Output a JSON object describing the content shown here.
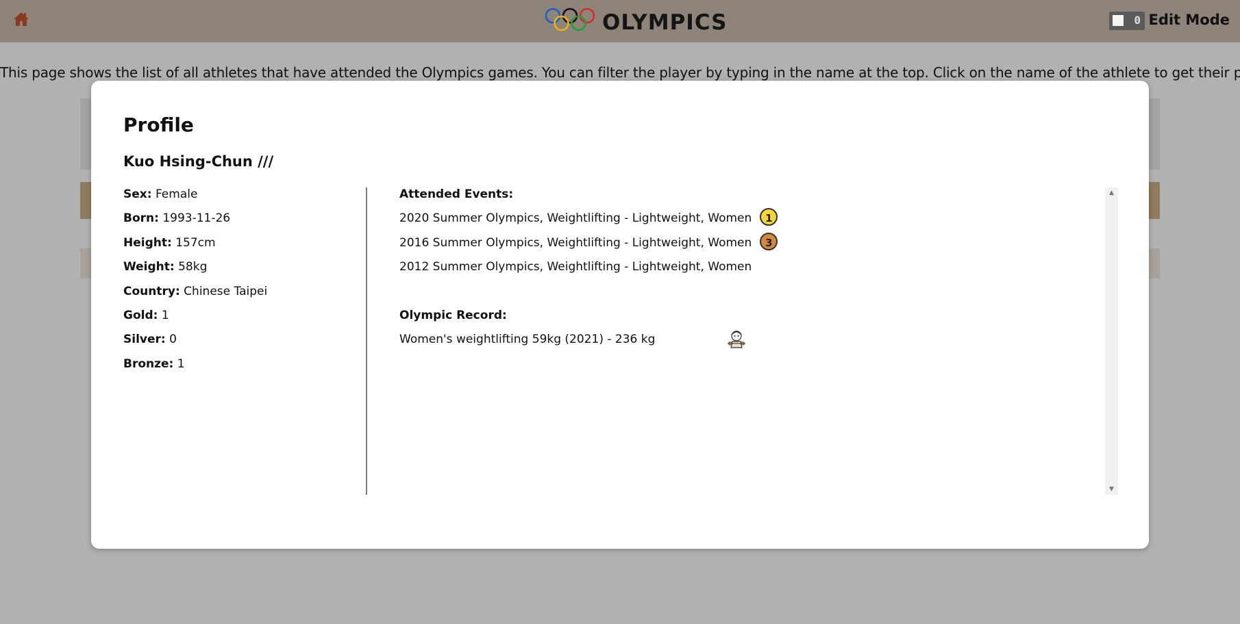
{
  "header": {
    "brand": "OLYMPICS",
    "toggle_value": "0",
    "edit_mode_label": "Edit Mode"
  },
  "intro_text": "This page shows the list of all athletes that have attended the Olympics games. You can filter the player by typing in the name at the top. Click on the name of the athlete to get their profile.",
  "modal": {
    "title": "Profile",
    "athlete_name": "Kuo Hsing-Chun ///",
    "stats": [
      {
        "label": "Sex:",
        "value": "Female"
      },
      {
        "label": "Born:",
        "value": "1993-11-26"
      },
      {
        "label": "Height:",
        "value": "157cm"
      },
      {
        "label": "Weight:",
        "value": "58kg"
      },
      {
        "label": "Country:",
        "value": "Chinese Taipei"
      },
      {
        "label": "Gold:",
        "value": "1"
      },
      {
        "label": "Silver:",
        "value": "0"
      },
      {
        "label": "Bronze:",
        "value": "1"
      }
    ],
    "events_title": "Attended Events:",
    "events": [
      {
        "text": "2020 Summer Olympics, Weightlifting - Lightweight, Women",
        "medal": "1",
        "medal_type": "gold"
      },
      {
        "text": "2016 Summer Olympics, Weightlifting - Lightweight, Women",
        "medal": "3",
        "medal_type": "bronze"
      },
      {
        "text": "2012 Summer Olympics, Weightlifting - Lightweight, Women",
        "medal": "",
        "medal_type": ""
      }
    ],
    "record_title": "Olympic Record:",
    "record_text": "Women's weightlifting 59kg (2021) - 236 kg"
  },
  "colors": {
    "header_bg": "#8f8479",
    "overlay_bg": "#b1b1b1",
    "gold": "#f5d63a",
    "bronze": "#d2883f",
    "home_icon": "#8a3a1e"
  },
  "icons": {
    "home": "home-icon",
    "rings": "olympic-rings-icon",
    "record": "record-holder-icon"
  }
}
